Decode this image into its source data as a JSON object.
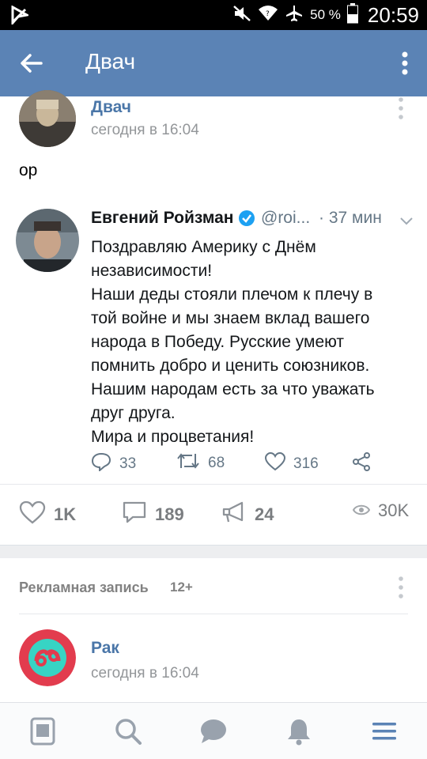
{
  "status_bar": {
    "battery_percent": "50 %",
    "time": "20:59"
  },
  "app_bar": {
    "title": "Двач"
  },
  "post": {
    "author": "Двач",
    "time": "сегодня в 16:04",
    "text": "ор",
    "tweet": {
      "name": "Евгений Ройзман",
      "handle": "@roi...",
      "time": "· 37 мин",
      "lines": [
        "Поздравляю  Америку с Днём",
        "независимости!",
        "Наши деды стояли плечом к плечу в",
        "той войне и мы знаем вклад вашего",
        "народа в Победу. Русские умеют",
        "помнить добро и ценить союзников.",
        "Нашим народам есть за что уважать",
        "друг друга.",
        "Мира и процветания!"
      ],
      "replies": "33",
      "retweets": "68",
      "likes": "316"
    },
    "stats": {
      "likes": "1K",
      "comments": "189",
      "reposts": "24",
      "views": "30K"
    }
  },
  "ad_post": {
    "label": "Рекламная запись",
    "age": "12+",
    "author": "Рак",
    "time": "сегодня в 16:04"
  },
  "bottom_nav": [
    "news-icon",
    "search-icon",
    "messages-icon",
    "notifications-icon",
    "menu-icon"
  ],
  "colors": {
    "accent": "#5b83b5",
    "link": "#4a76a8",
    "twitter_verified": "#1da1f2"
  }
}
